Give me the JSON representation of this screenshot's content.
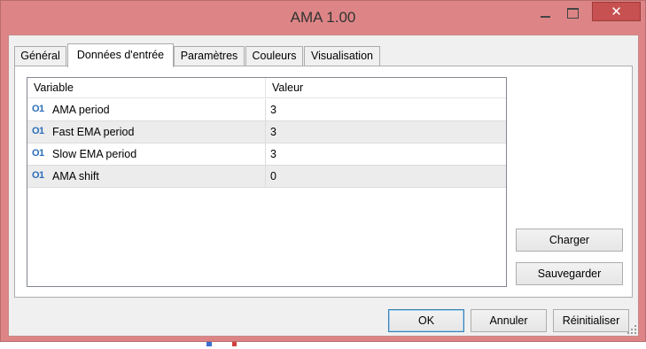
{
  "window": {
    "title": "AMA 1.00",
    "buttons": {
      "minimize": "minimize-icon",
      "maximize": "maximize-icon",
      "close": "close-icon"
    }
  },
  "tabs": [
    {
      "label": "Général",
      "active": false
    },
    {
      "label": "Données d'entrée",
      "active": true
    },
    {
      "label": "Paramètres",
      "active": false
    },
    {
      "label": "Couleurs",
      "active": false
    },
    {
      "label": "Visualisation",
      "active": false
    }
  ],
  "inputs_table": {
    "columns": [
      "Variable",
      "Valeur"
    ],
    "rows": [
      {
        "icon": "O1",
        "name": "AMA period",
        "value": "3"
      },
      {
        "icon": "O1",
        "name": "Fast EMA period",
        "value": "3"
      },
      {
        "icon": "O1",
        "name": "Slow EMA period",
        "value": "3"
      },
      {
        "icon": "O1",
        "name": "AMA shift",
        "value": "0"
      }
    ]
  },
  "side_buttons": {
    "load": "Charger",
    "save": "Sauvegarder"
  },
  "footer_buttons": {
    "ok": "OK",
    "cancel": "Annuler",
    "reset": "Réinitialiser"
  },
  "colors": {
    "frame": "#dd8586",
    "close": "#c75050",
    "icon": "#2a6db8"
  }
}
